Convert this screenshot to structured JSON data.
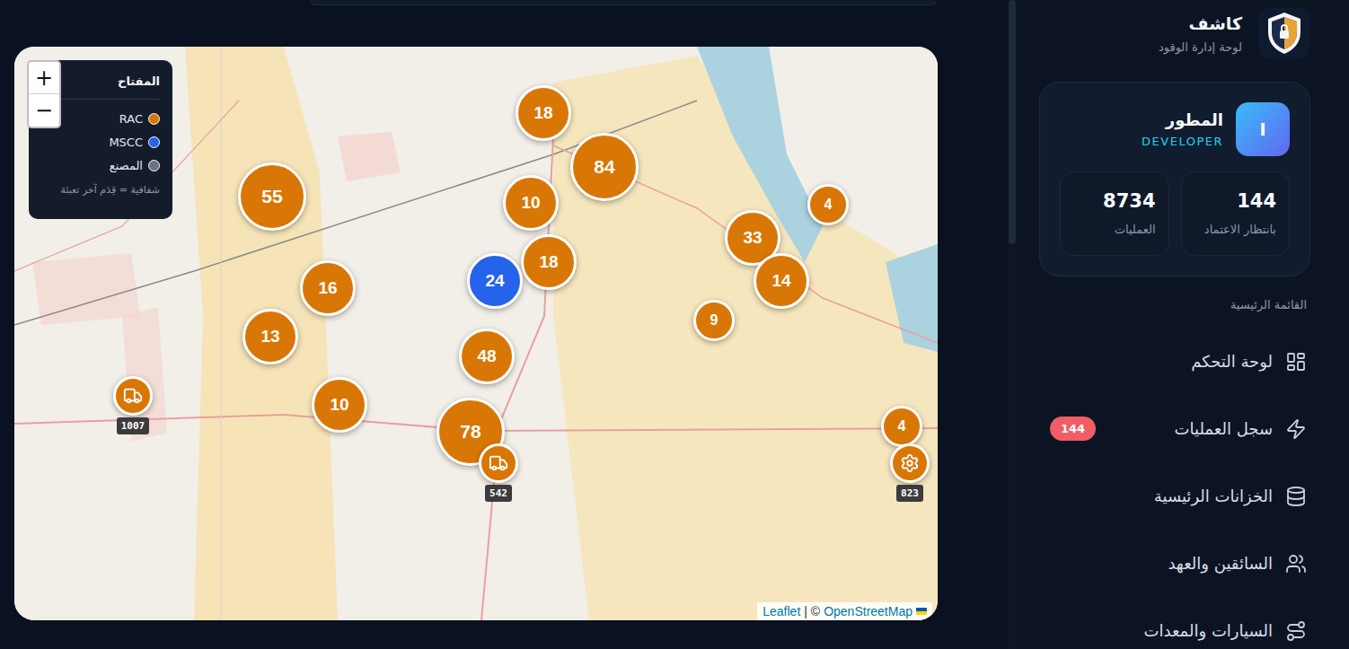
{
  "app": {
    "title": "كاشف",
    "subtitle": "لوحة إدارة الوقود"
  },
  "user": {
    "avatar": "I",
    "name": "المطور",
    "role": "DEVELOPER"
  },
  "stats": [
    {
      "value": "144",
      "label": "بانتظار الاعتماد"
    },
    {
      "value": "8734",
      "label": "العمليات"
    }
  ],
  "menu": {
    "title": "القائمة الرئيسية",
    "items": [
      {
        "label": "لوحة التحكم",
        "badge": "",
        "selected": false
      },
      {
        "label": "سجل العمليات",
        "badge": "144",
        "selected": false
      },
      {
        "label": "الخزانات الرئيسية",
        "badge": "",
        "selected": false
      },
      {
        "label": "السائقين والعهد",
        "badge": "",
        "selected": false
      },
      {
        "label": "السيارات والمعدات",
        "badge": "",
        "selected": false
      }
    ]
  },
  "map": {
    "zoom": {
      "in": "+",
      "out": "−"
    },
    "legend": {
      "title": "المفتاح",
      "items": [
        {
          "label": "RAC",
          "color": "#d97706"
        },
        {
          "label": "MSCC",
          "color": "#2563eb"
        },
        {
          "label": "المصنع",
          "color": "#6b7280"
        }
      ],
      "note": "شفافية = قِدَم آخر تعبئة"
    },
    "clusters": [
      {
        "count": "18",
        "color": "#d97706"
      },
      {
        "count": "84",
        "color": "#d97706"
      },
      {
        "count": "55",
        "color": "#d97706"
      },
      {
        "count": "10",
        "color": "#d97706"
      },
      {
        "count": "4",
        "color": "#d97706"
      },
      {
        "count": "33",
        "color": "#d97706"
      },
      {
        "count": "18",
        "color": "#d97706"
      },
      {
        "count": "24",
        "color": "#2563eb"
      },
      {
        "count": "16",
        "color": "#d97706"
      },
      {
        "count": "14",
        "color": "#d97706"
      },
      {
        "count": "9",
        "color": "#d97706"
      },
      {
        "count": "13",
        "color": "#d97706"
      },
      {
        "count": "48",
        "color": "#d97706"
      },
      {
        "count": "10",
        "color": "#d97706"
      },
      {
        "count": "78",
        "color": "#d97706"
      },
      {
        "count": "4",
        "color": "#d97706"
      }
    ],
    "markers": [
      {
        "kind": "truck",
        "label": "1007",
        "color": "#d97706"
      },
      {
        "kind": "truck",
        "label": "542",
        "color": "#d97706"
      },
      {
        "kind": "factory",
        "label": "823",
        "color": "#d97706"
      }
    ],
    "attribution": {
      "leaflet": "Leaflet",
      "separator": "| ©",
      "osm": "OpenStreetMap"
    }
  }
}
